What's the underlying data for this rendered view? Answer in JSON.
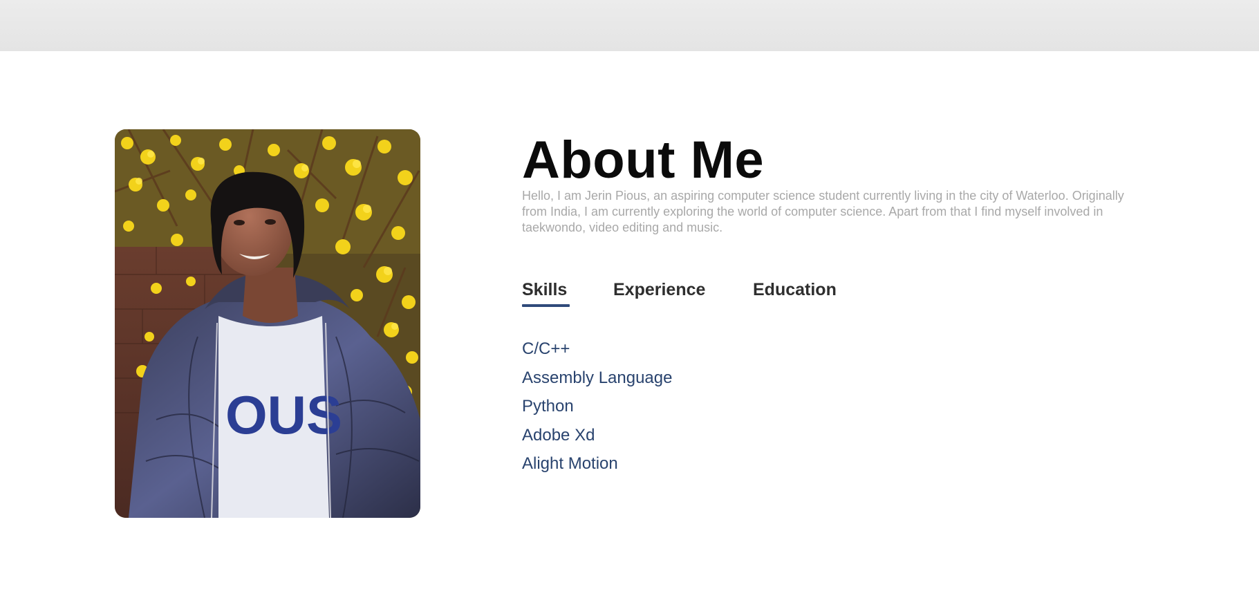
{
  "about": {
    "title": "About Me",
    "bio": "Hello, I am Jerin Pious, an aspiring computer science student currently living in the city of Waterloo. Originally from India, I am currently exploring the world of computer science. Apart from that I find myself involved in taekwondo, video editing and music."
  },
  "tabs": {
    "skills": "Skills",
    "experience": "Experience",
    "education": "Education",
    "active": "Skills"
  },
  "skills": [
    "C/C++",
    "Assembly Language",
    "Python",
    "Adobe Xd",
    "Alight Motion"
  ],
  "colors": {
    "accent": "#2f4a7a",
    "skill_text": "#29436e",
    "bio_text": "#a8a8a8",
    "title_text": "#0b0b0b"
  },
  "photo": {
    "subject": "portrait-photo",
    "shirt_print": "OUS"
  }
}
